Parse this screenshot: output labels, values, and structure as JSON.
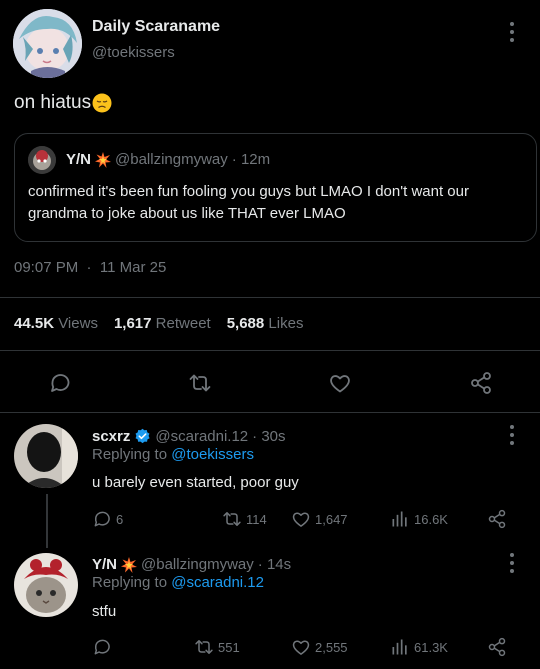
{
  "main_tweet": {
    "display_name": "Daily Scaraname",
    "handle": "@toekissers",
    "text": "on hiatus",
    "emoji": "disappointed-face-emoji",
    "timestamp": "09:07 PM",
    "date": "11 Mar 25",
    "stats": {
      "views_count": "44.5K",
      "views_label": "Views",
      "retweets_count": "1,617",
      "retweets_label": "Retweet",
      "likes_count": "5,688",
      "likes_label": "Likes"
    }
  },
  "quoted_tweet": {
    "display_name": "Y/N",
    "name_emoji": "collision-emoji",
    "handle": "@ballzingmyway",
    "time": "· 12m",
    "text": "confirmed it's been fun fooling you guys but LMAO I don't want our grandma to joke about us like THAT ever LMAO"
  },
  "replies": [
    {
      "display_name": "scxrz",
      "verified": true,
      "handle": "@scaradni.12",
      "time": "· 30s",
      "replying_prefix": "Replying to",
      "replying_to": "@toekissers",
      "text": "u barely even started, poor guy",
      "comments": "6",
      "retweets": "114",
      "likes": "1,647",
      "views": "16.6K"
    },
    {
      "display_name": "Y/N",
      "name_emoji": "collision-emoji",
      "handle": "@ballzingmyway",
      "time": "· 14s",
      "replying_prefix": "Replying to",
      "replying_to": "@scaradni.12",
      "text": "stfu",
      "comments": "",
      "retweets": "551",
      "likes": "2,555",
      "views": "61.3K"
    }
  ],
  "colors": {
    "background": "#000000",
    "text": "#e7e9ea",
    "secondary": "#71767b",
    "link": "#1d9bf0",
    "divider": "#2f3336"
  }
}
